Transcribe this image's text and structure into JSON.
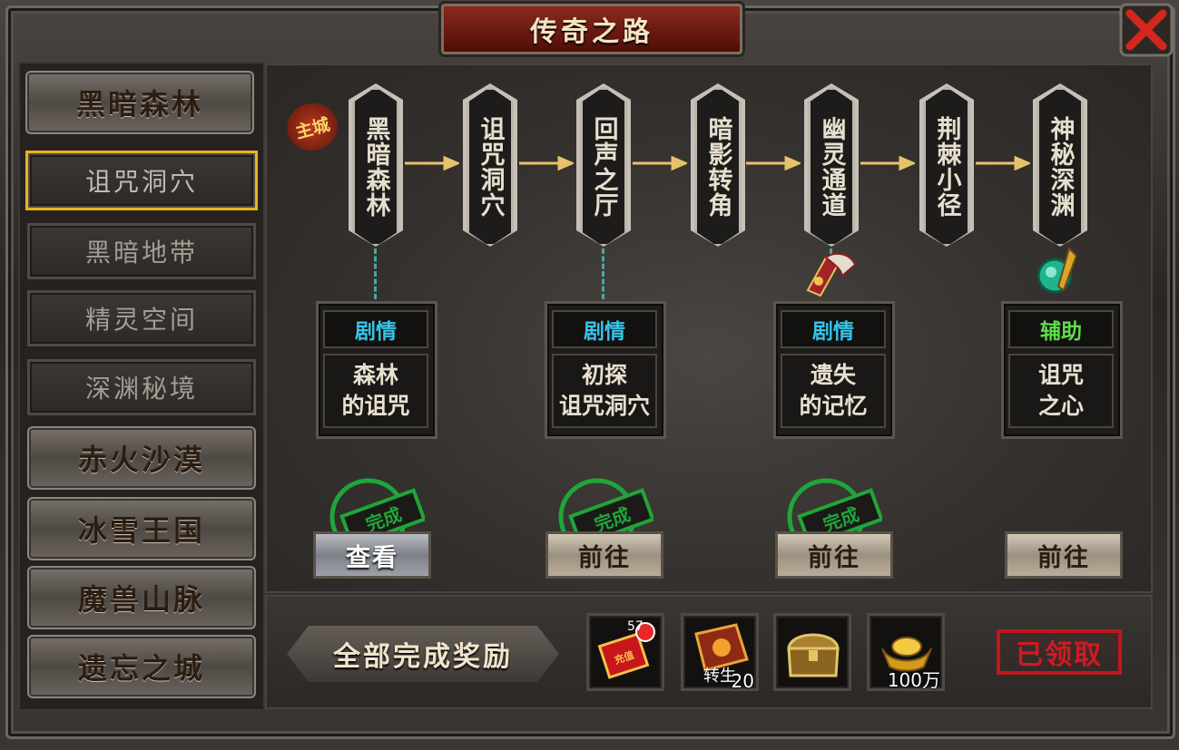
{
  "window": {
    "title": "传奇之路"
  },
  "sidebar": {
    "items": [
      {
        "label": "黑暗森林",
        "style": "big"
      },
      {
        "label": "诅咒洞穴",
        "style": "small",
        "selected": true
      },
      {
        "label": "黑暗地带",
        "style": "small"
      },
      {
        "label": "精灵空间",
        "style": "small"
      },
      {
        "label": "深渊秘境",
        "style": "small"
      },
      {
        "label": "赤火沙漠",
        "style": "big"
      },
      {
        "label": "冰雪王国",
        "style": "big"
      },
      {
        "label": "魔兽山脉",
        "style": "big"
      },
      {
        "label": "遗忘之城",
        "style": "big"
      }
    ]
  },
  "main": {
    "city_badge": "主城",
    "path_nodes": [
      "黑暗森林",
      "诅咒洞穴",
      "回声之厅",
      "暗影转角",
      "幽灵通道",
      "荆棘小径",
      "神秘深渊"
    ],
    "tasks": [
      {
        "type": "剧情",
        "name_line1": "森林",
        "name_line2": "的诅咒",
        "type_color": "#34c4e8",
        "completed": true,
        "button": "查看"
      },
      {
        "type": "剧情",
        "name_line1": "初探",
        "name_line2": "诅咒洞穴",
        "type_color": "#34c4e8",
        "completed": true,
        "button": "前往"
      },
      {
        "type": "剧情",
        "name_line1": "遗失",
        "name_line2": "的记忆",
        "type_color": "#34c4e8",
        "completed": true,
        "button": "前往"
      },
      {
        "type": "辅助",
        "name_line1": "诅咒",
        "name_line2": "之心",
        "type_color": "#5fdc4a",
        "completed": false,
        "button": "前往"
      }
    ],
    "stamp_text": "完成"
  },
  "reward": {
    "title": "全部完成奖励",
    "items": [
      {
        "icon": "red-envelope-icon",
        "badge": "57",
        "label": "充值",
        "count": ""
      },
      {
        "icon": "rebirth-book-icon",
        "label": "转生",
        "count": "20"
      },
      {
        "icon": "treasure-chest-icon",
        "count": ""
      },
      {
        "icon": "gold-ingot-icon",
        "count": "100万"
      }
    ],
    "status": "已领取"
  }
}
